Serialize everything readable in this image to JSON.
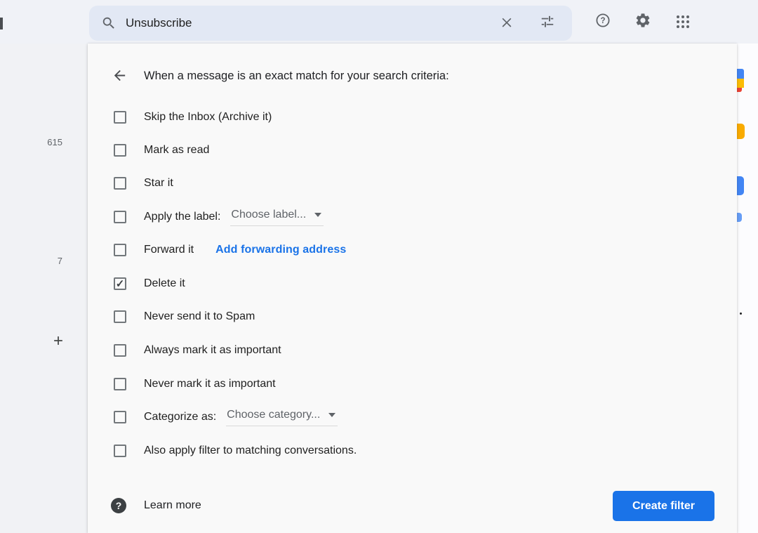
{
  "colors": {
    "accent_blue": "#1a73e8",
    "search_pill_bg": "#e2e8f4",
    "topbar_bg": "#f0f2f7",
    "dialog_bg": "#f9f9f9",
    "text_primary": "#202124",
    "text_secondary": "#5f6368",
    "fragment_yellow": "#f9ab00",
    "fragment_blue": "#4285f4",
    "fragment_red": "#ea4335"
  },
  "topbar": {
    "search_value": "Unsubscribe",
    "icons": [
      "search-icon",
      "close-icon",
      "tune-icon",
      "help-icon",
      "gear-icon",
      "apps-grid-icon"
    ]
  },
  "left_sidebar": {
    "badge_top": "615",
    "badge_bottom": "7",
    "plus_glyph": "+"
  },
  "filter_dialog": {
    "header": "When a message is an exact match for your search criteria:",
    "checkmark_glyph": "✓",
    "rows": [
      {
        "label": "Skip the Inbox (Archive it)",
        "checked": false
      },
      {
        "label": "Mark as read",
        "checked": false
      },
      {
        "label": "Star it",
        "checked": false
      },
      {
        "label": "Apply the label:",
        "checked": false,
        "dropdown_value": "Choose label..."
      },
      {
        "label": "Forward it",
        "checked": false,
        "link_label": "Add forwarding address"
      },
      {
        "label": "Delete it",
        "checked": true
      },
      {
        "label": "Never send it to Spam",
        "checked": false
      },
      {
        "label": "Always mark it as important",
        "checked": false
      },
      {
        "label": "Never mark it as important",
        "checked": false
      },
      {
        "label": "Categorize as:",
        "checked": false,
        "dropdown_value": "Choose category..."
      },
      {
        "label": "Also apply filter to matching conversations.",
        "checked": false
      }
    ],
    "footer": {
      "learn_more_label": "Learn more",
      "create_filter_label": "Create filter"
    }
  }
}
